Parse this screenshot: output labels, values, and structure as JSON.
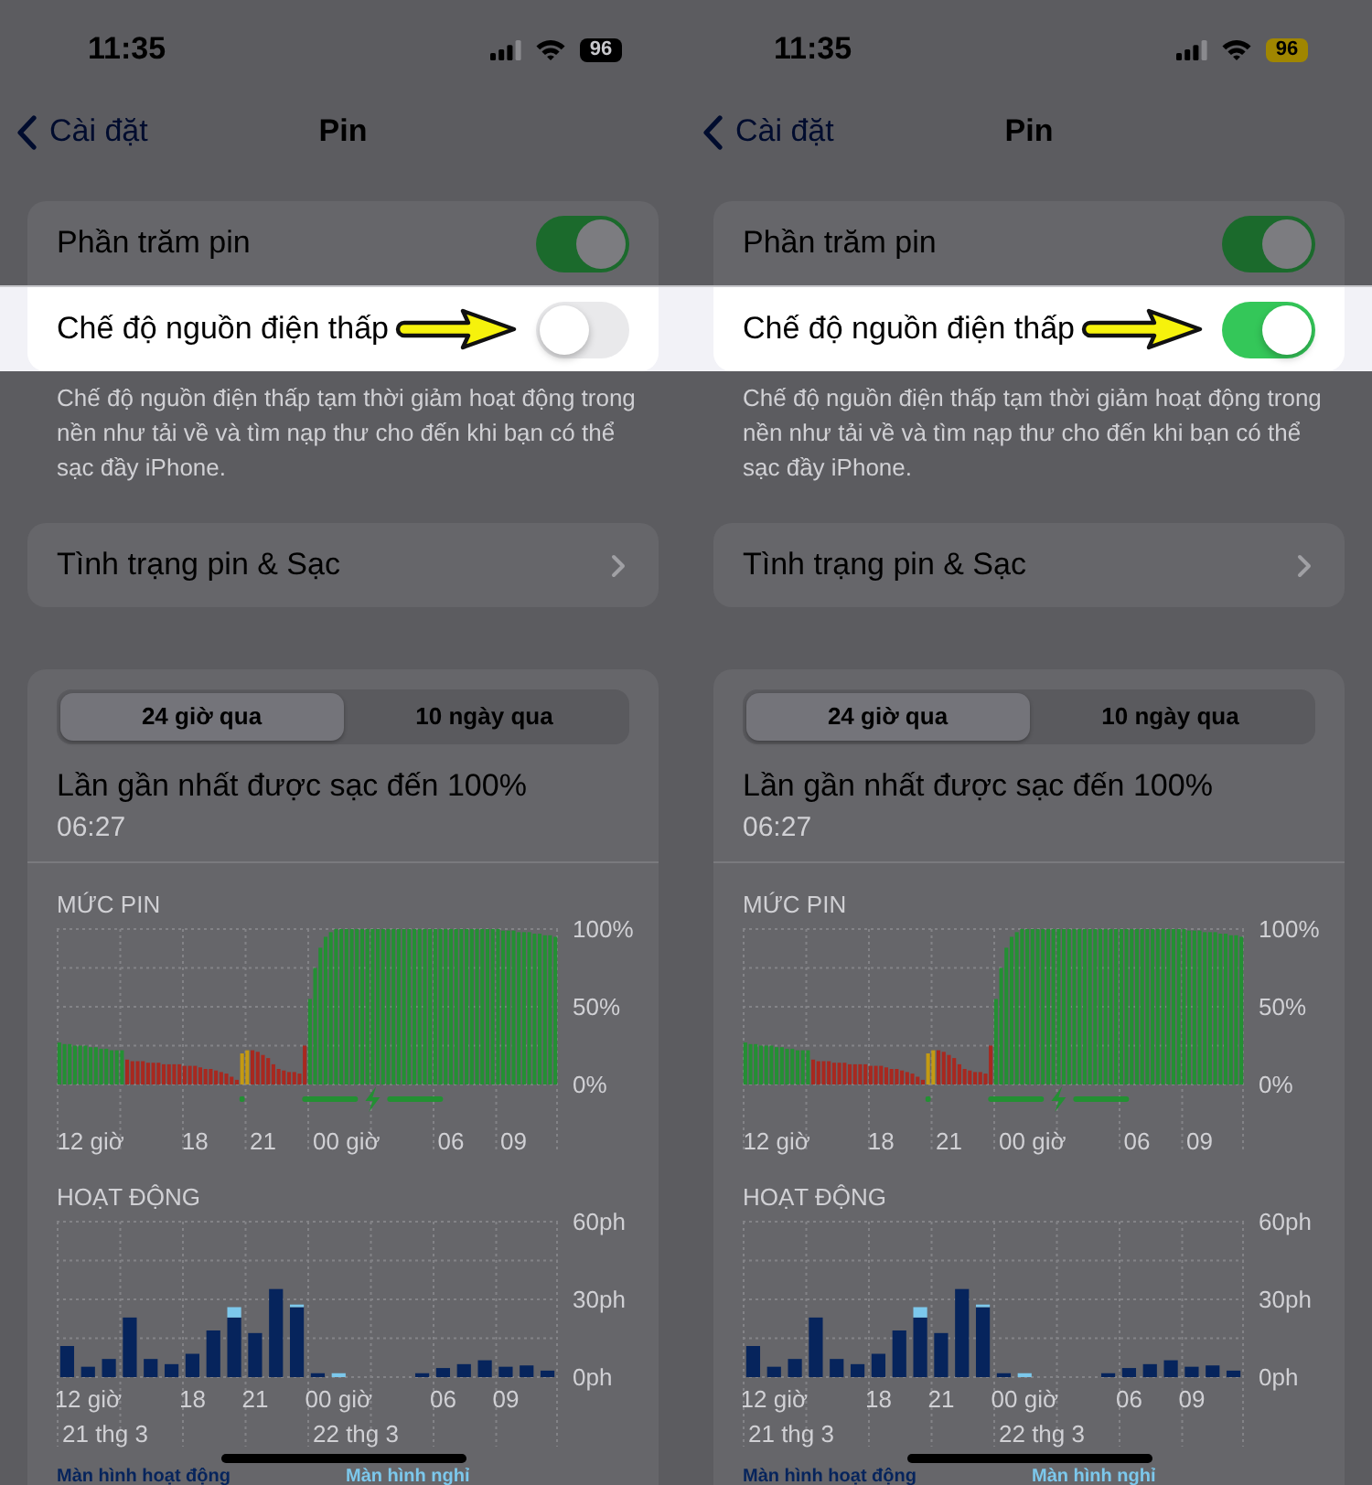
{
  "screens": [
    {
      "status_bar": {
        "time": "11:35",
        "battery": "96",
        "low_power": false
      },
      "nav": {
        "back": "Cài đặt",
        "title": "Pin"
      },
      "settings": [
        {
          "label": "Phần trăm pin",
          "on": true,
          "highlighted": false
        },
        {
          "label": "Chế độ nguồn điện thấp",
          "on": false,
          "highlighted": true
        }
      ],
      "description": "Chế độ nguồn điện thấp tạm thời giảm hoạt động trong nền như tải về và tìm nạp thư cho đến khi bạn có thể sạc đầy iPhone.",
      "health_row": {
        "label": "Tình trạng pin & Sạc"
      },
      "usage": {
        "tabs": [
          {
            "label": "24 giờ qua",
            "selected": true
          },
          {
            "label": "10 ngày qua",
            "selected": false
          }
        ],
        "last_charged": {
          "title": "Lần gần nhất được sạc đến 100%",
          "time": "06:27"
        },
        "battery_chart": {
          "chart_data": {
            "type": "bar",
            "title": "MỨC PIN",
            "categories": [
              null,
              null,
              null,
              null,
              null,
              null,
              "12 giờ",
              null,
              null,
              null,
              null,
              null,
              null,
              null,
              null,
              null,
              null,
              null,
              null,
              null,
              null,
              null,
              null,
              null,
              null,
              null,
              "18",
              null,
              null,
              null,
              null,
              null,
              null,
              null,
              null,
              null,
              null,
              null,
              null,
              "21",
              null,
              null,
              null,
              null,
              null,
              null,
              null,
              null,
              null,
              null,
              null,
              null,
              null,
              null,
              null,
              "00 giờ",
              null,
              null,
              null,
              null,
              null,
              null,
              null,
              null,
              null,
              null,
              null,
              null,
              null,
              null,
              null,
              null,
              null,
              null,
              null,
              "06",
              null,
              null,
              null,
              null,
              null,
              null,
              null,
              null,
              null,
              null,
              null,
              "09",
              null,
              null,
              null,
              null,
              null,
              null,
              null,
              null
            ],
            "ylim": [
              0,
              100
            ],
            "yticks": [
              {
                "value": 0,
                "label": "0%"
              },
              {
                "value": 50,
                "label": "50%"
              },
              {
                "value": 100,
                "label": "100%"
              }
            ],
            "series": [
              {
                "color": "#239033",
                "values": [
                  27,
                  26,
                  26,
                  25,
                  25,
                  25,
                  24,
                  24,
                  23,
                  23,
                  22,
                  22,
                  22,
                  null,
                  null,
                  null,
                  null,
                  null,
                  null,
                  null,
                  null,
                  null,
                  null,
                  null,
                  null,
                  null,
                  null,
                  null,
                  null,
                  null,
                  null,
                  null,
                  null,
                  null,
                  null,
                  null,
                  null,
                  null,
                  null,
                  null,
                  null,
                  null,
                  null,
                  null,
                  null,
                  null,
                  null,
                  null,
                  55,
                  75,
                  88,
                  95,
                  98,
                  100,
                  100,
                  100,
                  100,
                  100,
                  100,
                  100,
                  100,
                  100,
                  100,
                  100,
                  100,
                  100,
                  100,
                  100,
                  100,
                  100,
                  100,
                  100,
                  100,
                  100,
                  100,
                  100,
                  100,
                  100,
                  100,
                  100,
                  100,
                  100,
                  100,
                  100,
                  100,
                  99,
                  99,
                  99,
                  98,
                  98,
                  98,
                  97,
                  97,
                  96,
                  96,
                  95
                ]
              },
              {
                "color": "#a8281f",
                "values": [
                  null,
                  null,
                  null,
                  null,
                  null,
                  null,
                  null,
                  null,
                  null,
                  null,
                  null,
                  null,
                  null,
                  16,
                  15,
                  15,
                  15,
                  14,
                  14,
                  14,
                  13,
                  13,
                  13,
                  13,
                  12,
                  12,
                  12,
                  11,
                  10,
                  10,
                  9,
                  8,
                  7,
                  5,
                  3,
                  null,
                  null,
                  22,
                  21,
                  19,
                  17,
                  13,
                  10,
                  9,
                  8,
                  8,
                  7,
                  25,
                  null,
                  null,
                  null,
                  null,
                  null,
                  null,
                  null,
                  null,
                  null,
                  null,
                  null,
                  null,
                  null,
                  null,
                  null,
                  null,
                  null,
                  null,
                  null,
                  null,
                  null,
                  null,
                  null,
                  null,
                  null,
                  null,
                  null,
                  null,
                  null,
                  null,
                  null,
                  null,
                  null,
                  null,
                  null,
                  null,
                  null,
                  null,
                  null,
                  null,
                  null,
                  null,
                  null,
                  null,
                  null,
                  null,
                  null,
                  null
                ]
              },
              {
                "color": "#c49a12",
                "values": [
                  null,
                  null,
                  null,
                  null,
                  null,
                  null,
                  null,
                  null,
                  null,
                  null,
                  null,
                  null,
                  null,
                  null,
                  null,
                  null,
                  null,
                  null,
                  null,
                  null,
                  null,
                  null,
                  null,
                  null,
                  null,
                  null,
                  null,
                  null,
                  null,
                  null,
                  null,
                  null,
                  null,
                  null,
                  null,
                  20,
                  22,
                  null,
                  null,
                  null,
                  null,
                  null,
                  null,
                  null,
                  null,
                  null,
                  null,
                  null,
                  null,
                  null,
                  null,
                  null,
                  null,
                  null,
                  null,
                  null,
                  null,
                  null,
                  null,
                  null,
                  null,
                  null,
                  null,
                  null,
                  null,
                  null,
                  null,
                  null,
                  null,
                  null,
                  null,
                  null,
                  null,
                  null,
                  null,
                  null,
                  null,
                  null,
                  null,
                  null,
                  null,
                  null,
                  null,
                  null,
                  null,
                  null,
                  null,
                  null,
                  null,
                  null,
                  null,
                  null,
                  null,
                  null,
                  null,
                  null
                ]
              }
            ]
          }
        },
        "activity_chart": {
          "chart_data": {
            "type": "bar",
            "title": "HOẠT ĐỘNG",
            "stacked": true,
            "categories": [
              null,
              "12 giờ",
              null,
              null,
              null,
              null,
              "18",
              null,
              null,
              "21",
              null,
              null,
              null,
              "00 giờ",
              null,
              null,
              null,
              null,
              "06",
              null,
              null,
              "09",
              null,
              null
            ],
            "ylim": [
              0,
              60
            ],
            "yticks": [
              {
                "value": 0,
                "label": "0ph"
              },
              {
                "value": 30,
                "label": "30ph"
              },
              {
                "value": 60,
                "label": "60ph"
              }
            ],
            "series": [
              {
                "name": "Màn hình hoạt động",
                "color": "#06245c",
                "values": [
                  12,
                  4,
                  7,
                  23,
                  7,
                  5,
                  9,
                  18,
                  23,
                  17,
                  34,
                  27,
                  1.5,
                  0,
                  0,
                  0,
                  0,
                  1.5,
                  3.5,
                  5,
                  6.5,
                  4,
                  4.5,
                  2.5
                ]
              },
              {
                "name": "Màn hình nghỉ",
                "color": "#7cc8ec",
                "values": [
                  0,
                  0,
                  0,
                  0,
                  0,
                  0,
                  0,
                  0,
                  4,
                  0,
                  0,
                  1,
                  0,
                  1.5,
                  0,
                  0,
                  0,
                  0,
                  0,
                  0,
                  0,
                  0,
                  0,
                  0
                ]
              }
            ]
          },
          "dates": [
            "21 thg 3",
            "22 thg 3"
          ]
        }
      }
    },
    {
      "status_bar": {
        "time": "11:35",
        "battery": "96",
        "low_power": true
      },
      "nav": {
        "back": "Cài đặt",
        "title": "Pin"
      },
      "settings": [
        {
          "label": "Phần trăm pin",
          "on": true,
          "highlighted": false
        },
        {
          "label": "Chế độ nguồn điện thấp",
          "on": true,
          "highlighted": true
        }
      ],
      "description": "Chế độ nguồn điện thấp tạm thời giảm hoạt động trong nền như tải về và tìm nạp thư cho đến khi bạn có thể sạc đầy iPhone.",
      "health_row": {
        "label": "Tình trạng pin & Sạc"
      },
      "usage": {
        "tabs": [
          {
            "label": "24 giờ qua",
            "selected": true
          },
          {
            "label": "10 ngày qua",
            "selected": false
          }
        ],
        "last_charged": {
          "title": "Lần gần nhất được sạc đến 100%",
          "time": "06:27"
        },
        "battery_chart": {
          "chart_data": {
            "type": "bar",
            "title": "MỨC PIN",
            "categories": [
              null,
              null,
              null,
              null,
              null,
              null,
              "12 giờ",
              null,
              null,
              null,
              null,
              null,
              null,
              null,
              null,
              null,
              null,
              null,
              null,
              null,
              null,
              null,
              null,
              null,
              null,
              null,
              "18",
              null,
              null,
              null,
              null,
              null,
              null,
              null,
              null,
              null,
              null,
              null,
              null,
              "21",
              null,
              null,
              null,
              null,
              null,
              null,
              null,
              null,
              null,
              null,
              null,
              null,
              null,
              null,
              null,
              "00 giờ",
              null,
              null,
              null,
              null,
              null,
              null,
              null,
              null,
              null,
              null,
              null,
              null,
              null,
              null,
              null,
              null,
              null,
              null,
              null,
              "06",
              null,
              null,
              null,
              null,
              null,
              null,
              null,
              null,
              null,
              null,
              null,
              "09",
              null,
              null,
              null,
              null,
              null,
              null,
              null,
              null
            ],
            "ylim": [
              0,
              100
            ],
            "yticks": [
              {
                "value": 0,
                "label": "0%"
              },
              {
                "value": 50,
                "label": "50%"
              },
              {
                "value": 100,
                "label": "100%"
              }
            ],
            "series": [
              {
                "color": "#239033",
                "values": [
                  27,
                  26,
                  26,
                  25,
                  25,
                  25,
                  24,
                  24,
                  23,
                  23,
                  22,
                  22,
                  22,
                  null,
                  null,
                  null,
                  null,
                  null,
                  null,
                  null,
                  null,
                  null,
                  null,
                  null,
                  null,
                  null,
                  null,
                  null,
                  null,
                  null,
                  null,
                  null,
                  null,
                  null,
                  null,
                  null,
                  null,
                  null,
                  null,
                  null,
                  null,
                  null,
                  null,
                  null,
                  null,
                  null,
                  null,
                  null,
                  55,
                  75,
                  88,
                  95,
                  98,
                  100,
                  100,
                  100,
                  100,
                  100,
                  100,
                  100,
                  100,
                  100,
                  100,
                  100,
                  100,
                  100,
                  100,
                  100,
                  100,
                  100,
                  100,
                  100,
                  100,
                  100,
                  100,
                  100,
                  100,
                  100,
                  100,
                  100,
                  100,
                  100,
                  100,
                  100,
                  100,
                  99,
                  99,
                  99,
                  98,
                  98,
                  98,
                  97,
                  97,
                  96,
                  96,
                  95
                ]
              },
              {
                "color": "#a8281f",
                "values": [
                  null,
                  null,
                  null,
                  null,
                  null,
                  null,
                  null,
                  null,
                  null,
                  null,
                  null,
                  null,
                  null,
                  16,
                  15,
                  15,
                  15,
                  14,
                  14,
                  14,
                  13,
                  13,
                  13,
                  13,
                  12,
                  12,
                  12,
                  11,
                  10,
                  10,
                  9,
                  8,
                  7,
                  5,
                  3,
                  null,
                  null,
                  22,
                  21,
                  19,
                  17,
                  13,
                  10,
                  9,
                  8,
                  8,
                  7,
                  25,
                  null,
                  null,
                  null,
                  null,
                  null,
                  null,
                  null,
                  null,
                  null,
                  null,
                  null,
                  null,
                  null,
                  null,
                  null,
                  null,
                  null,
                  null,
                  null,
                  null,
                  null,
                  null,
                  null,
                  null,
                  null,
                  null,
                  null,
                  null,
                  null,
                  null,
                  null,
                  null,
                  null,
                  null,
                  null,
                  null,
                  null,
                  null,
                  null,
                  null,
                  null,
                  null,
                  null,
                  null,
                  null,
                  null,
                  null,
                  null
                ]
              },
              {
                "color": "#c49a12",
                "values": [
                  null,
                  null,
                  null,
                  null,
                  null,
                  null,
                  null,
                  null,
                  null,
                  null,
                  null,
                  null,
                  null,
                  null,
                  null,
                  null,
                  null,
                  null,
                  null,
                  null,
                  null,
                  null,
                  null,
                  null,
                  null,
                  null,
                  null,
                  null,
                  null,
                  null,
                  null,
                  null,
                  null,
                  null,
                  null,
                  20,
                  22,
                  null,
                  null,
                  null,
                  null,
                  null,
                  null,
                  null,
                  null,
                  null,
                  null,
                  null,
                  null,
                  null,
                  null,
                  null,
                  null,
                  null,
                  null,
                  null,
                  null,
                  null,
                  null,
                  null,
                  null,
                  null,
                  null,
                  null,
                  null,
                  null,
                  null,
                  null,
                  null,
                  null,
                  null,
                  null,
                  null,
                  null,
                  null,
                  null,
                  null,
                  null,
                  null,
                  null,
                  null,
                  null,
                  null,
                  null,
                  null,
                  null,
                  null,
                  null,
                  null,
                  null,
                  null,
                  null,
                  null,
                  null,
                  null,
                  null
                ]
              }
            ]
          }
        },
        "activity_chart": {
          "chart_data": {
            "type": "bar",
            "title": "HOẠT ĐỘNG",
            "stacked": true,
            "categories": [
              null,
              "12 giờ",
              null,
              null,
              null,
              null,
              "18",
              null,
              null,
              "21",
              null,
              null,
              null,
              "00 giờ",
              null,
              null,
              null,
              null,
              "06",
              null,
              null,
              "09",
              null,
              null
            ],
            "ylim": [
              0,
              60
            ],
            "yticks": [
              {
                "value": 0,
                "label": "0ph"
              },
              {
                "value": 30,
                "label": "30ph"
              },
              {
                "value": 60,
                "label": "60ph"
              }
            ],
            "series": [
              {
                "name": "Màn hình hoạt động",
                "color": "#06245c",
                "values": [
                  12,
                  4,
                  7,
                  23,
                  7,
                  5,
                  9,
                  18,
                  23,
                  17,
                  34,
                  27,
                  1.5,
                  0,
                  0,
                  0,
                  0,
                  1.5,
                  3.5,
                  5,
                  6.5,
                  4,
                  4.5,
                  2.5
                ]
              },
              {
                "name": "Màn hình nghỉ",
                "color": "#7cc8ec",
                "values": [
                  0,
                  0,
                  0,
                  0,
                  0,
                  0,
                  0,
                  0,
                  4,
                  0,
                  0,
                  1,
                  0,
                  1.5,
                  0,
                  0,
                  0,
                  0,
                  0,
                  0,
                  0,
                  0,
                  0,
                  0
                ]
              }
            ]
          },
          "dates": [
            "21 thg 3",
            "22 thg 3"
          ]
        }
      }
    }
  ]
}
